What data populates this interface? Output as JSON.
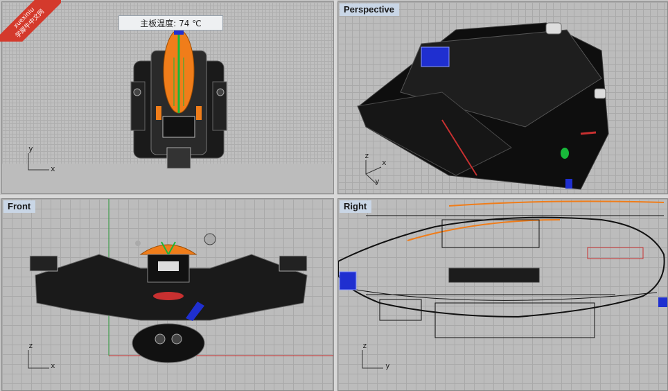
{
  "watermark": {
    "line1": "xuexiniu",
    "line2": "学犀牛中文网"
  },
  "tooltip": {
    "text": "主板温度: 74 ℃"
  },
  "viewports": {
    "top": {
      "title": "",
      "axis_a": "y",
      "axis_b": "x"
    },
    "perspective": {
      "title": "Perspective",
      "axis_a": "z",
      "axis_b": "x",
      "axis_c": "y"
    },
    "front": {
      "title": "Front",
      "axis_a": "z",
      "axis_b": "x"
    },
    "right": {
      "title": "Right",
      "axis_a": "z",
      "axis_b": "y"
    }
  },
  "colors": {
    "model": "#111111",
    "highlight_orange": "#f07d1a",
    "highlight_green": "#18b83a",
    "highlight_blue": "#1f2fd0",
    "grid_axis_red": "#c83030",
    "grid_axis_green": "#2a9a3a",
    "watermark_red": "#d43a2c"
  }
}
